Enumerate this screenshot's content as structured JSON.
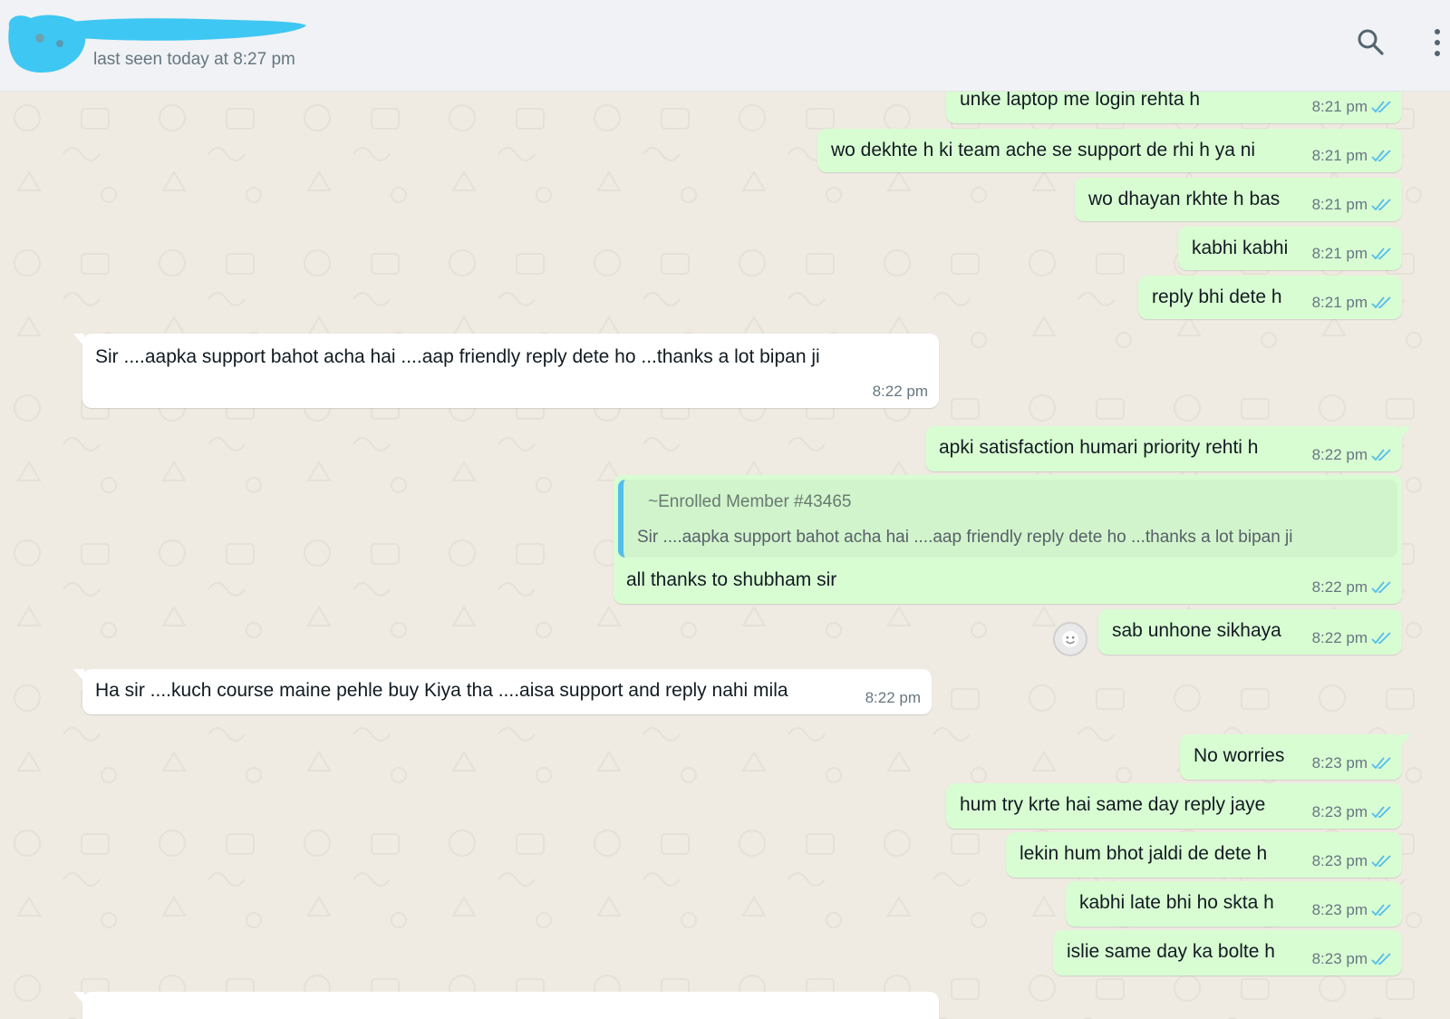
{
  "header": {
    "status": "last seen today at 8:27 pm",
    "search_icon": "search-icon",
    "menu_icon": "more-vertical-icon"
  },
  "colors": {
    "outgoing_bubble": "#d9fdd3",
    "incoming_bubble": "#ffffff",
    "read_ticks": "#53bdeb",
    "chat_background": "#efeae2"
  },
  "messages": [
    {
      "dir": "out",
      "text": "unke laptop me login rehta h",
      "time": "8:21 pm",
      "read": true
    },
    {
      "dir": "out",
      "text": "wo dekhte h ki team ache se support de rhi h ya ni",
      "time": "8:21 pm",
      "read": true
    },
    {
      "dir": "out",
      "text": "wo dhayan rkhte h bas",
      "time": "8:21 pm",
      "read": true
    },
    {
      "dir": "out",
      "text": "kabhi kabhi",
      "time": "8:21 pm",
      "read": true
    },
    {
      "dir": "out",
      "text": "reply bhi dete h",
      "time": "8:21 pm",
      "read": true
    },
    {
      "dir": "in",
      "text": "Sir ....aapka support bahot acha hai ....aap friendly reply dete ho ...thanks a lot bipan ji",
      "time": "8:22 pm"
    },
    {
      "dir": "out",
      "text": "apki satisfaction humari priority rehti h",
      "time": "8:22 pm",
      "read": true
    },
    {
      "dir": "out",
      "quote_author": "~Enrolled Member #43465",
      "quote_text": "Sir ....aapka support bahot acha hai ....aap friendly reply dete ho ...thanks a lot bipan ji",
      "text": "all thanks to shubham sir",
      "time": "8:22 pm",
      "read": true
    },
    {
      "dir": "out",
      "text": "sab unhone sikhaya",
      "time": "8:22 pm",
      "read": true
    },
    {
      "dir": "in",
      "text": "Ha sir ....kuch course maine pehle buy Kiya tha ....aisa support and reply nahi mila",
      "time": "8:22 pm"
    },
    {
      "dir": "out",
      "text": "No worries",
      "time": "8:23 pm",
      "read": true
    },
    {
      "dir": "out",
      "text": "hum try krte hai same day reply jaye",
      "time": "8:23 pm",
      "read": true
    },
    {
      "dir": "out",
      "text": "lekin hum bhot jaldi de dete h",
      "time": "8:23 pm",
      "read": true
    },
    {
      "dir": "out",
      "text": "kabhi late bhi ho skta h",
      "time": "8:23 pm",
      "read": true
    },
    {
      "dir": "out",
      "text": "islie same day ka bolte h",
      "time": "8:23 pm",
      "read": true
    }
  ]
}
